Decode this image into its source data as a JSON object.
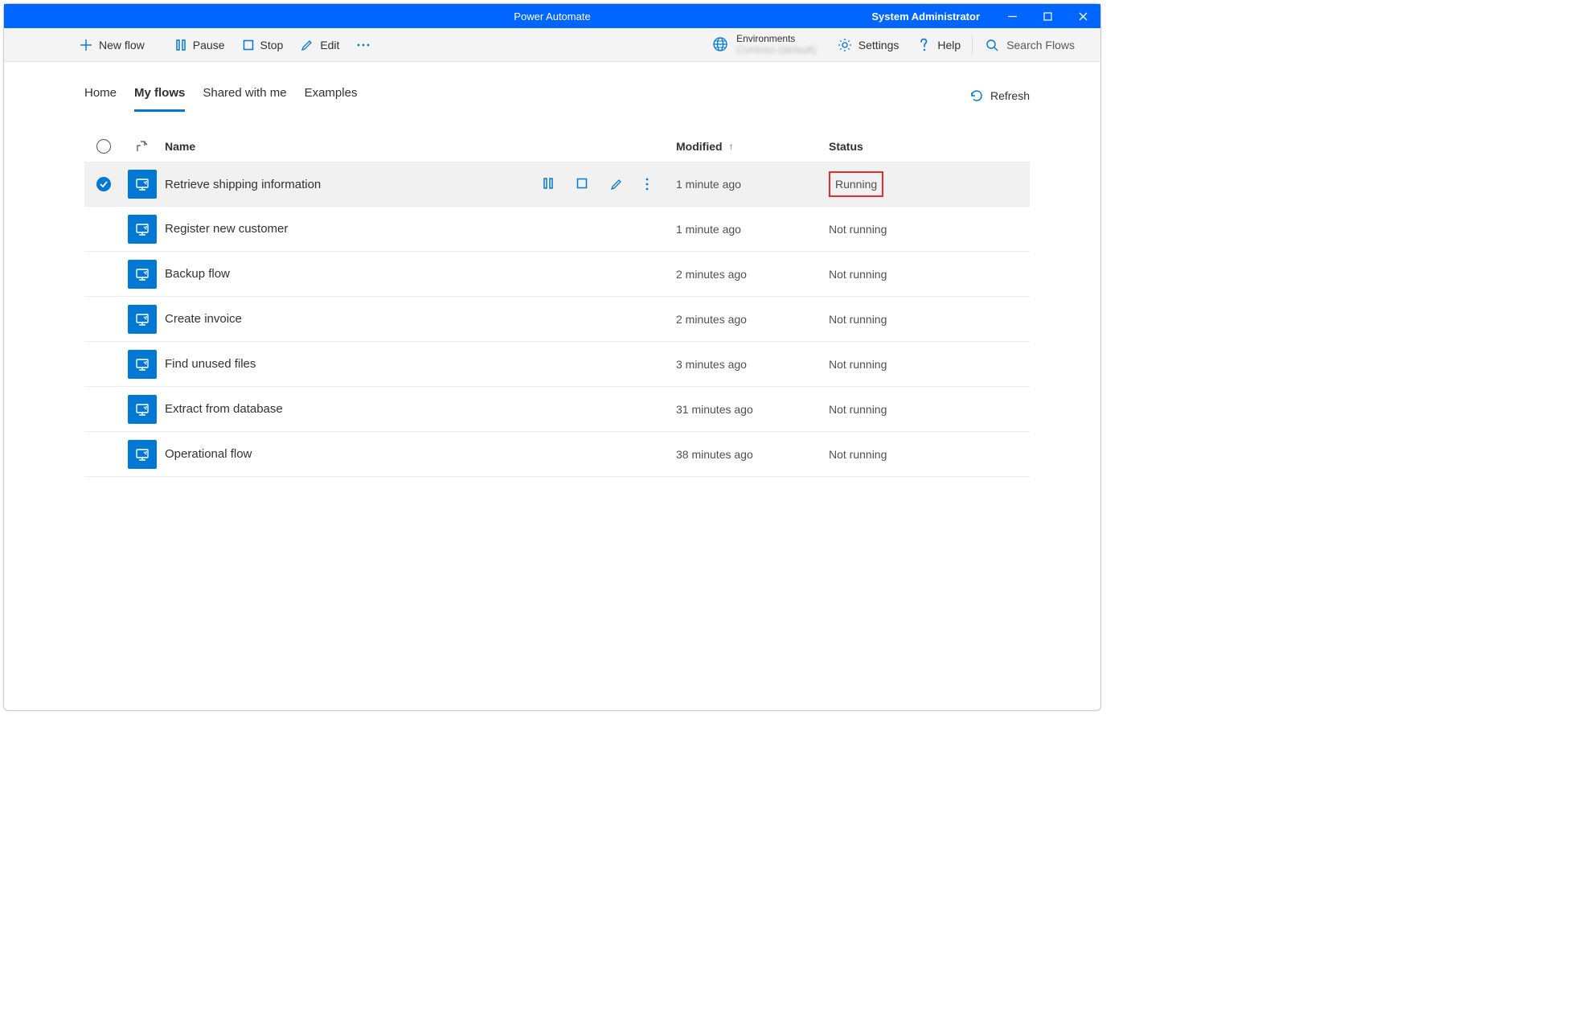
{
  "titlebar": {
    "app_title": "Power Automate",
    "user": "System Administrator"
  },
  "toolbar": {
    "new_flow": "New flow",
    "pause": "Pause",
    "stop": "Stop",
    "edit": "Edit",
    "environments_label": "Environments",
    "environments_value": "Contoso (default)",
    "settings": "Settings",
    "help": "Help",
    "search_placeholder": "Search Flows"
  },
  "tabs": {
    "home": "Home",
    "my_flows": "My flows",
    "shared": "Shared with me",
    "examples": "Examples"
  },
  "refresh_label": "Refresh",
  "columns": {
    "name": "Name",
    "modified": "Modified",
    "status": "Status"
  },
  "flows": [
    {
      "name": "Retrieve shipping information",
      "modified": "1 minute ago",
      "status": "Running",
      "selected": true,
      "highlight": true
    },
    {
      "name": "Register new customer",
      "modified": "1 minute ago",
      "status": "Not running"
    },
    {
      "name": "Backup flow",
      "modified": "2 minutes ago",
      "status": "Not running"
    },
    {
      "name": "Create invoice",
      "modified": "2 minutes ago",
      "status": "Not running"
    },
    {
      "name": "Find unused files",
      "modified": "3 minutes ago",
      "status": "Not running"
    },
    {
      "name": "Extract from database",
      "modified": "31 minutes ago",
      "status": "Not running"
    },
    {
      "name": "Operational flow",
      "modified": "38 minutes ago",
      "status": "Not running"
    }
  ]
}
